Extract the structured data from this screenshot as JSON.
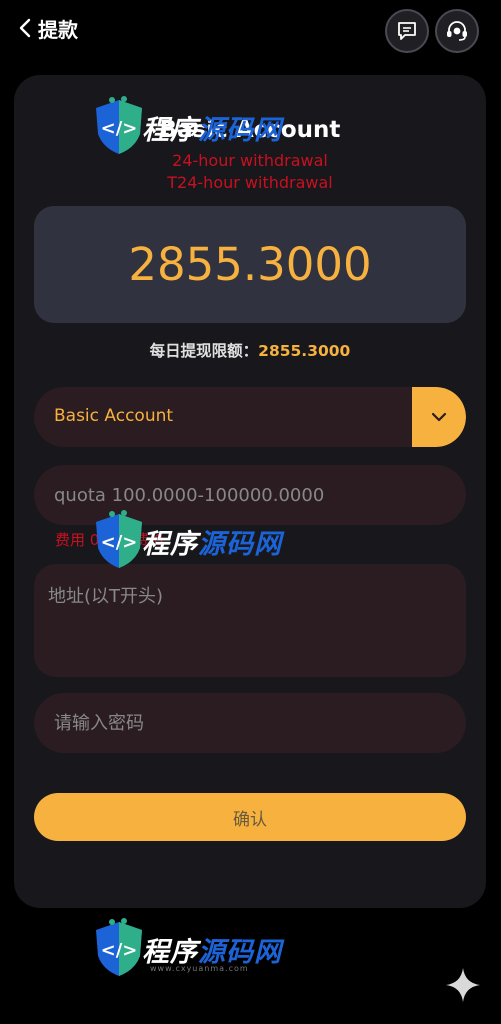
{
  "header": {
    "title": "提款"
  },
  "card": {
    "account_title": "Basic Account",
    "red_line_1": "24-hour withdrawal",
    "red_line_2": "T24-hour withdrawal",
    "balance": "2855.3000",
    "daily_limit_label": "每日提现限额：",
    "daily_limit_value": "2855.3000",
    "account_select_value": "Basic Account",
    "quota_placeholder": "quota 100.0000-100000.0000",
    "fee_text": "费用 0  手续费 0",
    "address_placeholder": "地址(以T开头)",
    "password_placeholder": "请输入密码",
    "confirm_label": "确认"
  },
  "watermark": {
    "text_white": "程序",
    "text_blue": "源码网",
    "url": "www.cxyuanma.com"
  },
  "colors": {
    "accent": "#f6b13f",
    "card_bg": "#17171c",
    "field_bg": "#2a1c20",
    "balance_bg": "#30323f",
    "warning_red": "#c9101f"
  }
}
